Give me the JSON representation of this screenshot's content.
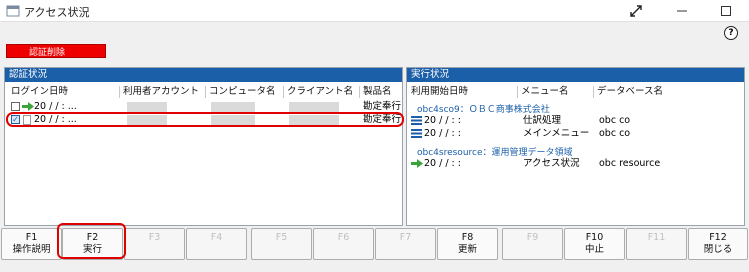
{
  "window": {
    "title": "アクセス状況",
    "help_label": "?"
  },
  "toolbar": {
    "delete_label": "認証削除"
  },
  "left_panel": {
    "title": "認証状況",
    "columns": [
      "ログイン日時",
      "利用者アカウント",
      "コンピュータ名",
      "クライアント名",
      "製品名"
    ],
    "rows": [
      {
        "checked": false,
        "date": "20  /  /    :  ...",
        "product": "勘定奉行"
      },
      {
        "checked": true,
        "date": "20  /  /    :  ...",
        "product": "勘定奉行"
      }
    ]
  },
  "right_panel": {
    "title": "実行状況",
    "columns": [
      "利用開始日時",
      "メニュー名",
      "データベース名"
    ],
    "groups": [
      {
        "label": "obc4sco9：ＯＢＣ商事株式会社",
        "rows": [
          {
            "date": "20  /  /    :  :",
            "menu": "仕訳処理",
            "db": "obc  co"
          },
          {
            "date": "20  /  /    :  :",
            "menu": "メインメニュー",
            "db": "obc  co"
          }
        ]
      },
      {
        "label": "obc4sresource：運用管理データ領域",
        "rows": [
          {
            "date": "20  /  /    :  :",
            "menu": "アクセス状況",
            "db": "obc  resource"
          }
        ]
      }
    ]
  },
  "function_keys": [
    {
      "key": "F1",
      "label": "操作説明",
      "enabled": true
    },
    {
      "key": "F2",
      "label": "実行",
      "enabled": true
    },
    {
      "key": "F3",
      "label": "",
      "enabled": false
    },
    {
      "key": "F4",
      "label": "",
      "enabled": false
    },
    {
      "key": "F5",
      "label": "",
      "enabled": false
    },
    {
      "key": "F6",
      "label": "",
      "enabled": false
    },
    {
      "key": "F7",
      "label": "",
      "enabled": false
    },
    {
      "key": "F8",
      "label": "更新",
      "enabled": true
    },
    {
      "key": "F9",
      "label": "",
      "enabled": false
    },
    {
      "key": "F10",
      "label": "中止",
      "enabled": true
    },
    {
      "key": "F11",
      "label": "",
      "enabled": false
    },
    {
      "key": "F12",
      "label": "閉じる",
      "enabled": true
    }
  ],
  "colors": {
    "header_blue": "#1b5fa8",
    "delete_red": "#ee0000",
    "highlight_red": "#e00000"
  }
}
